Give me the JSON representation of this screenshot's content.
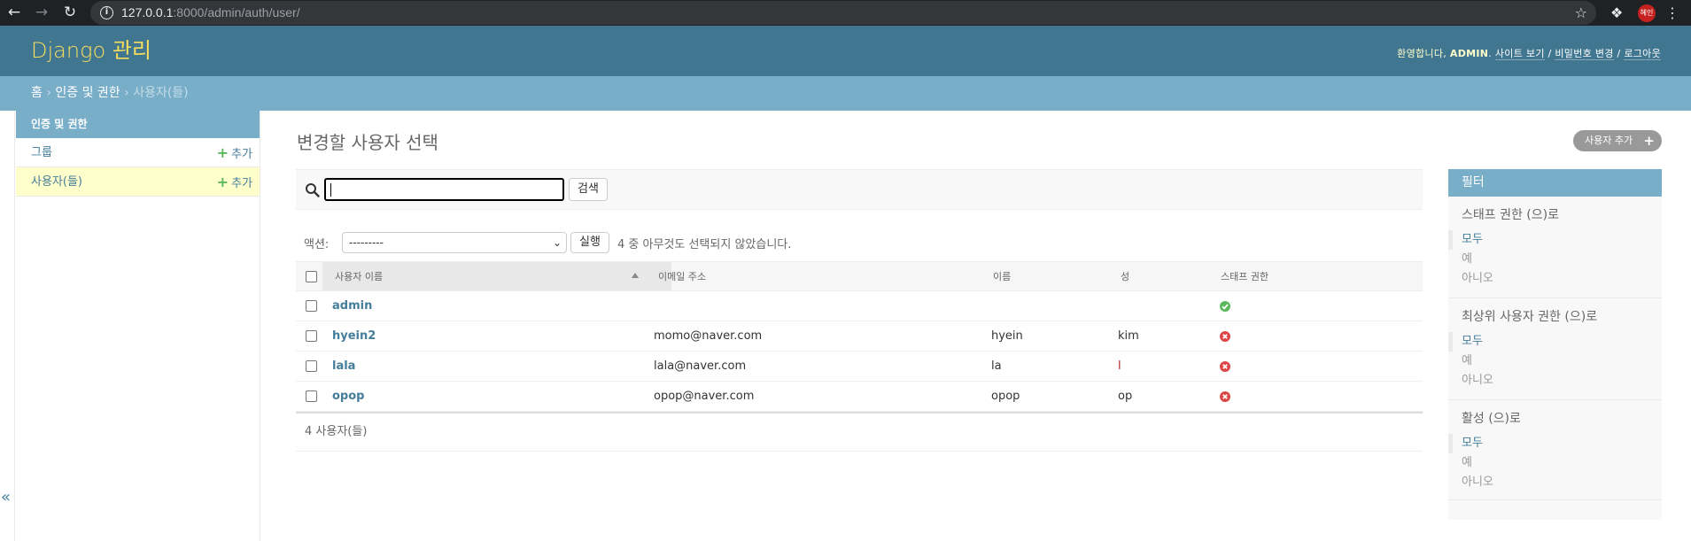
{
  "browser": {
    "url_host": "127.0.0.1",
    "url_rest": ":8000/admin/auth/user/",
    "profile_label": "혜인"
  },
  "header": {
    "brand": "Django 관리",
    "welcome": "환영합니다,",
    "username": "ADMIN",
    "links": [
      "사이트 보기",
      "비밀번호 변경",
      "로그아웃"
    ]
  },
  "breadcrumbs": {
    "home": "홈",
    "app": "인증 및 권한",
    "current": "사용자(들)"
  },
  "sidebar": {
    "caption": "인증 및 권한",
    "items": [
      {
        "label": "그룹",
        "add": "추가",
        "current": false
      },
      {
        "label": "사용자(들)",
        "add": "추가",
        "current": true
      }
    ]
  },
  "main": {
    "title": "변경할 사용자 선택",
    "add_button": "사용자 추가",
    "search_value": "",
    "search_button": "검색",
    "action_label": "액션:",
    "action_selected": "---------",
    "action_go": "실행",
    "selection_counter": "4 중 아무것도 선택되지 않았습니다.",
    "columns": [
      "사용자 이름",
      "이메일 주소",
      "이름",
      "성",
      "스태프 권한"
    ],
    "rows": [
      {
        "username": "admin",
        "email": "",
        "first_name": "",
        "last_name": "",
        "is_staff": true
      },
      {
        "username": "hyein2",
        "email": "momo@naver.com",
        "first_name": "hyein",
        "last_name": "kim",
        "is_staff": false
      },
      {
        "username": "lala",
        "email": "lala@naver.com",
        "first_name": "la",
        "last_name": "l",
        "is_staff": false
      },
      {
        "username": "opop",
        "email": "opop@naver.com",
        "first_name": "opop",
        "last_name": "op",
        "is_staff": false
      }
    ],
    "paginator": "4 사용자(들)"
  },
  "filter": {
    "title": "필터",
    "groups": [
      {
        "title": "스태프 권한 (으)로",
        "options": [
          "모두",
          "예",
          "아니오"
        ],
        "selected": 0
      },
      {
        "title": "최상위 사용자 권한 (으)로",
        "options": [
          "모두",
          "예",
          "아니오"
        ],
        "selected": 0
      },
      {
        "title": "활성 (으)로",
        "options": [
          "모두",
          "예",
          "아니오"
        ],
        "selected": 0
      }
    ]
  },
  "colors": {
    "header_bg": "#417690",
    "breadcrumb_bg": "#79aec8",
    "brand": "#f5dd5d",
    "link": "#447e9b",
    "current_bg": "#ffffcc",
    "ok": "#5cb85c",
    "no": "#dd4646"
  }
}
